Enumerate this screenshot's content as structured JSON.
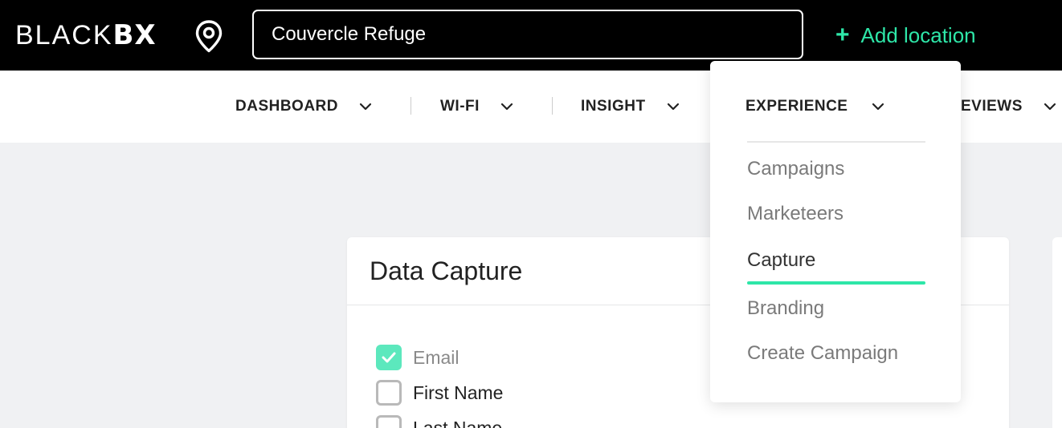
{
  "header": {
    "logo_light": "BLACK",
    "logo_bold": "BX",
    "search_value": "Couvercle Refuge",
    "add_location_icon": "plus-icon",
    "add_location_label": "Add location",
    "accent_color": "#2ee6a8"
  },
  "nav": {
    "items": [
      {
        "label": "DASHBOARD"
      },
      {
        "label": "WI-FI"
      },
      {
        "label": "INSIGHT"
      },
      {
        "label": "EXPERIENCE"
      },
      {
        "label": "EVIEWS"
      }
    ]
  },
  "dropdown": {
    "title": "EXPERIENCE",
    "items": [
      {
        "label": "Campaigns"
      },
      {
        "label": "Marketeers"
      },
      {
        "label": "Capture",
        "active": true
      },
      {
        "label": "Branding"
      },
      {
        "label": "Create Campaign"
      }
    ]
  },
  "card": {
    "title": "Data Capture",
    "fields": [
      {
        "label": "Email",
        "checked": true,
        "disabled": true
      },
      {
        "label": "First Name",
        "checked": false
      },
      {
        "label": "Last Name",
        "checked": false
      }
    ],
    "checkbox_color": "#5ce8bd"
  }
}
